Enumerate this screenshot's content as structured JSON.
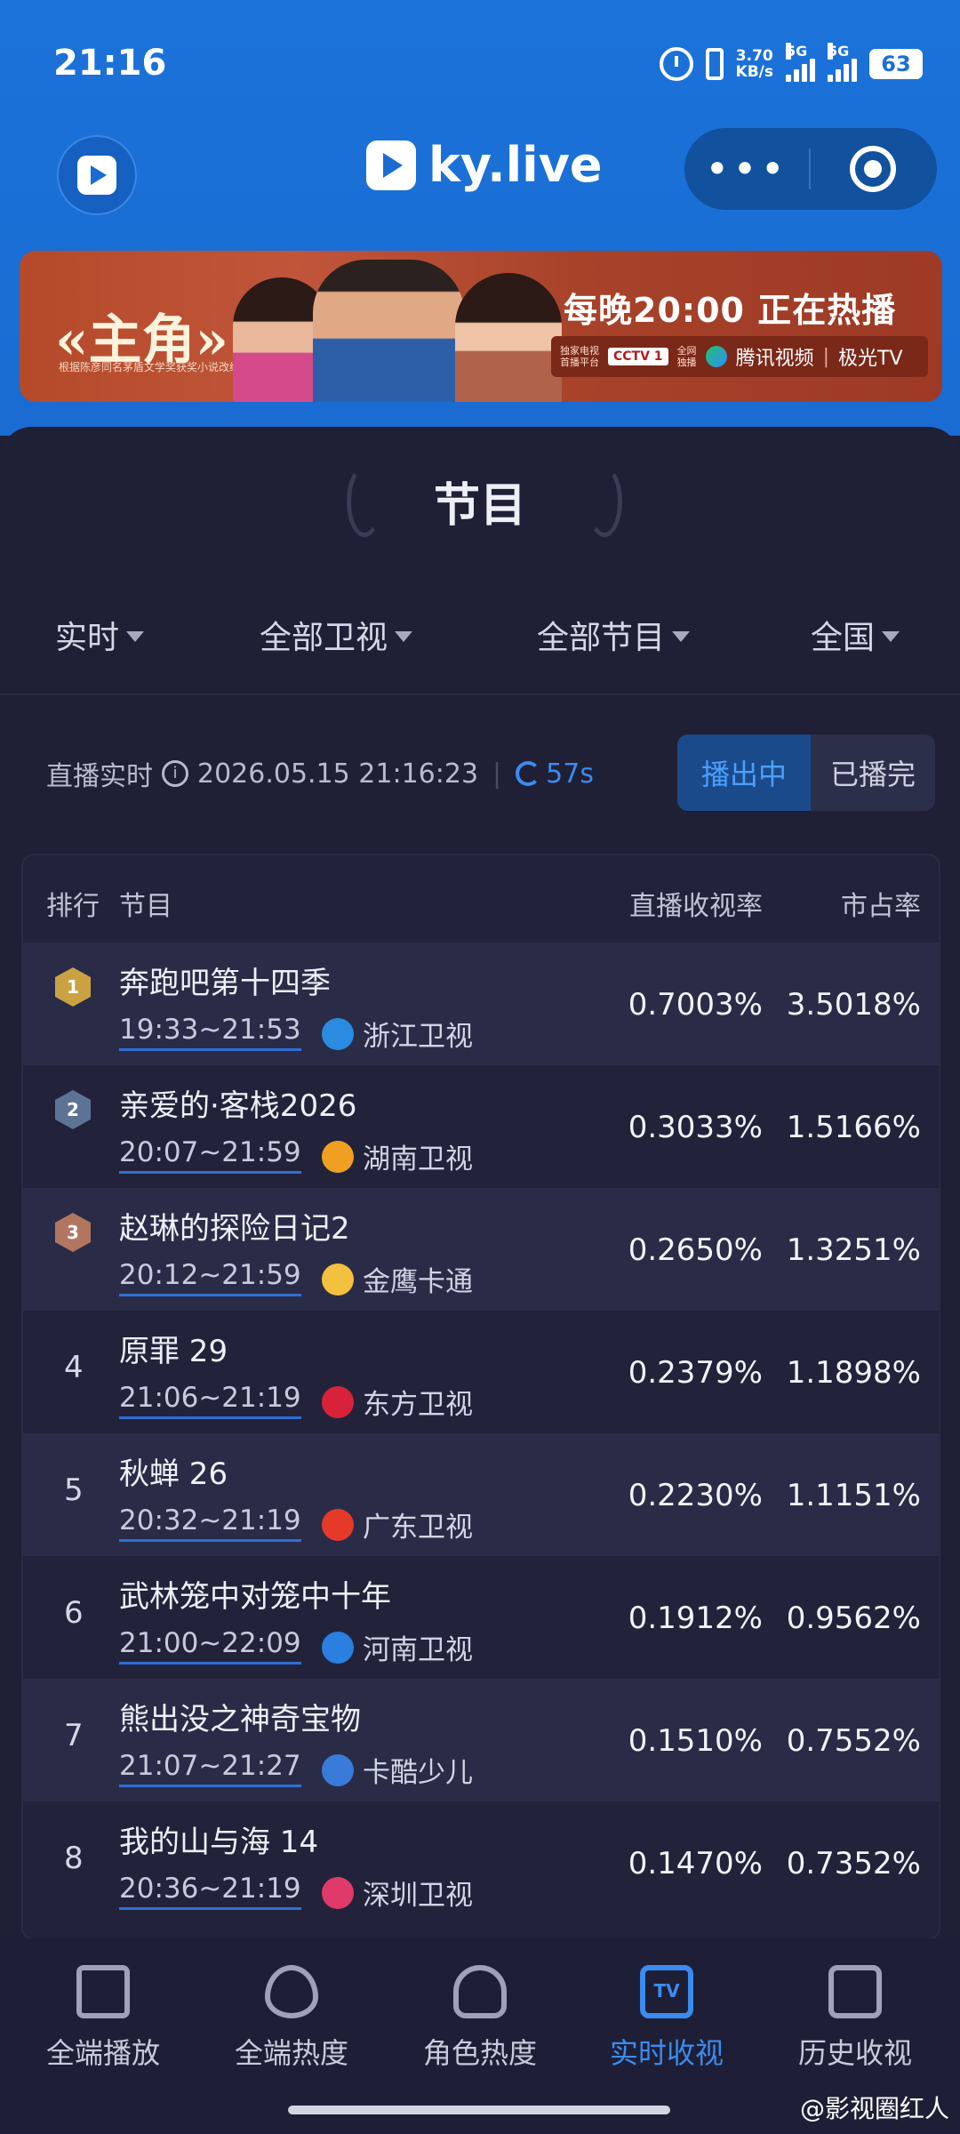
{
  "status_bar": {
    "time": "21:16",
    "net_speed": "3.70",
    "net_unit": "KB/s",
    "sig1": "5G",
    "sig2": "5G",
    "battery": "63"
  },
  "header": {
    "brand": "ky.live",
    "more_glyph": "•••"
  },
  "banner": {
    "title": "«主角»",
    "note": "根据陈彦同名茅盾文学奖获奖小说改编",
    "slogan": "每晚20:00 正在热播",
    "partner_small": "独家电视\n首播平台",
    "partner_cctv": "CCTV 1",
    "partner_small2": "全网\n独播",
    "partner_tencent": "腾讯视频",
    "partner_jiguang": "极光TV"
  },
  "page": {
    "section_title": "节目",
    "filters": [
      "实时",
      "全部卫视",
      "全部节目",
      "全国"
    ],
    "live_label": "直播实时",
    "live_datetime": "2026.05.15 21:16:23",
    "refresh_countdown": "57s",
    "toggle_on": "播出中",
    "toggle_off": "已播完"
  },
  "table": {
    "headers": {
      "rank": "排行",
      "program": "节目",
      "rating": "直播收视率",
      "share": "市占率"
    },
    "rows": [
      {
        "rank": "1",
        "name": "奔跑吧第十四季",
        "time": "19:33~21:53",
        "channel": "浙江卫视",
        "rating": "0.7003%",
        "share": "3.5018%",
        "logo_color": "#2a8be0"
      },
      {
        "rank": "2",
        "name": "亲爱的·客栈2026",
        "time": "20:07~21:59",
        "channel": "湖南卫视",
        "rating": "0.3033%",
        "share": "1.5166%",
        "logo_color": "#f0a020"
      },
      {
        "rank": "3",
        "name": "赵琳的探险日记2",
        "time": "20:12~21:59",
        "channel": "金鹰卡通",
        "rating": "0.2650%",
        "share": "1.3251%",
        "logo_color": "#f4c040"
      },
      {
        "rank": "4",
        "name": "原罪 29",
        "time": "21:06~21:19",
        "channel": "东方卫视",
        "rating": "0.2379%",
        "share": "1.1898%",
        "logo_color": "#d8223a"
      },
      {
        "rank": "5",
        "name": "秋蝉 26",
        "time": "20:32~21:19",
        "channel": "广东卫视",
        "rating": "0.2230%",
        "share": "1.1151%",
        "logo_color": "#e53a2a"
      },
      {
        "rank": "6",
        "name": "武林笼中对笼中十年",
        "time": "21:00~22:09",
        "channel": "河南卫视",
        "rating": "0.1912%",
        "share": "0.9562%",
        "logo_color": "#2a7fe0"
      },
      {
        "rank": "7",
        "name": "熊出没之神奇宝物",
        "time": "21:07~21:27",
        "channel": "卡酷少儿",
        "rating": "0.1510%",
        "share": "0.7552%",
        "logo_color": "#3a7ad8"
      },
      {
        "rank": "8",
        "name": "我的山与海 14",
        "time": "20:36~21:19",
        "channel": "深圳卫视",
        "rating": "0.1470%",
        "share": "0.7352%",
        "logo_color": "#e03a6a"
      }
    ]
  },
  "bottom_nav": {
    "tabs": [
      "全端播放",
      "全端热度",
      "角色热度",
      "实时收视",
      "历史收视"
    ],
    "active_index": 3,
    "tv_icon_text": "TV"
  },
  "watermark": "@影视圈红人",
  "colors": {
    "accent": "#3a8cf0",
    "header_blue": "#1a6cd2",
    "background": "#1e1f36"
  }
}
